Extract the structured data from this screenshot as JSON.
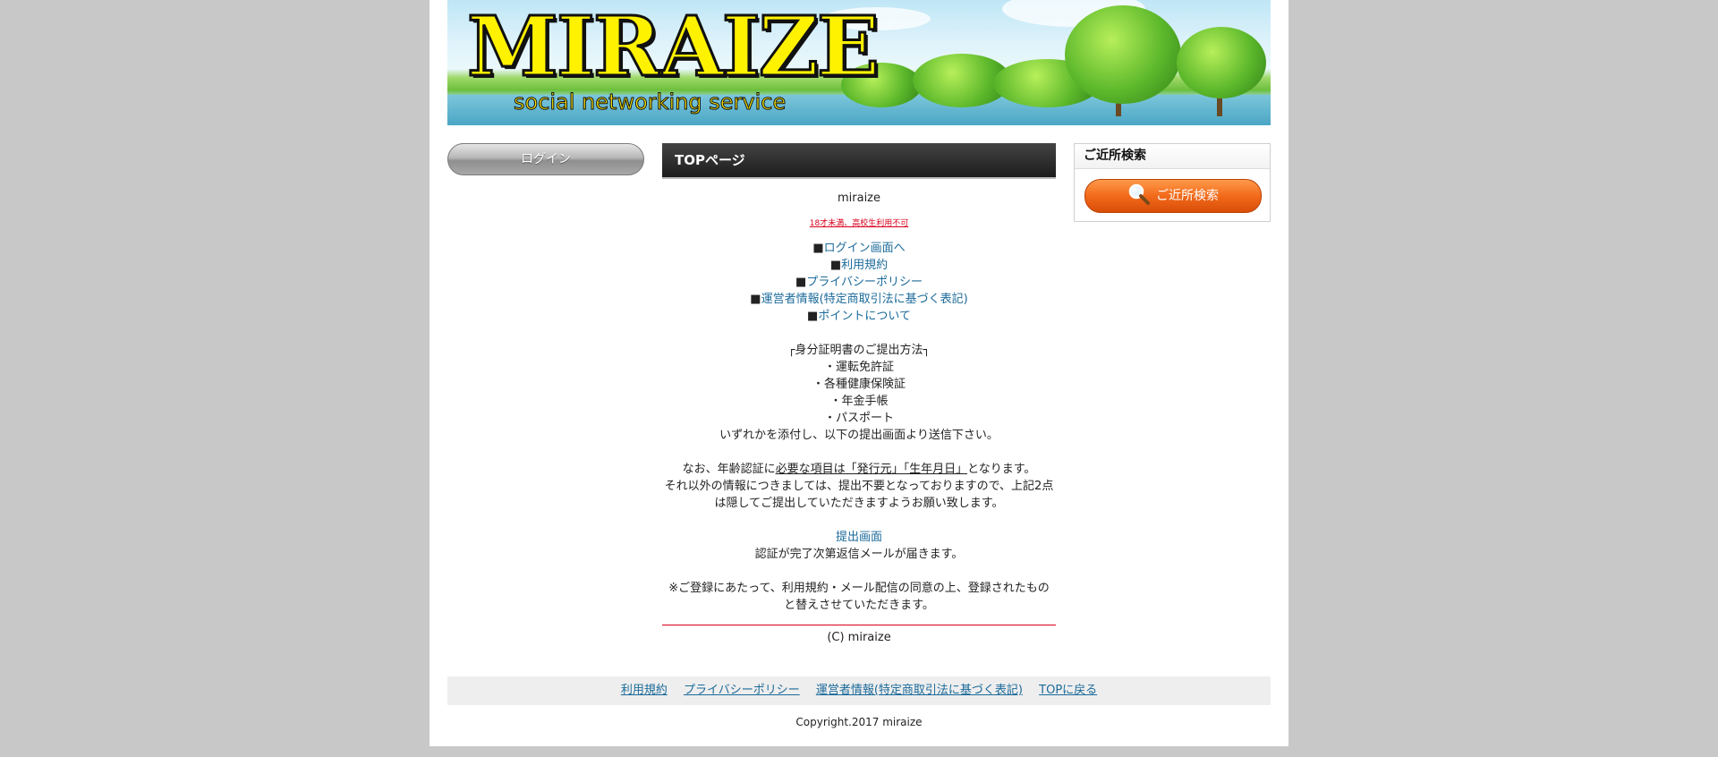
{
  "banner": {
    "brand": "MIRAIZE",
    "tagline": "social networking service"
  },
  "left": {
    "login_label": "ログイン"
  },
  "main": {
    "title": "TOPページ",
    "site_name": "miraize",
    "age_notice": "18才未満、高校生利用不可",
    "bullet": "■",
    "links": [
      "ログイン画面へ",
      "利用規約",
      "プライバシーポリシー",
      "運営者情報(特定商取引法に基づく表記)",
      "ポイントについて"
    ],
    "id_heading": "┌身分証明書のご提出方法┐",
    "id_items": [
      "・運転免許証",
      "・各種健康保険証",
      "・年金手帳",
      "・パスポート"
    ],
    "id_instruction": "いずれかを添付し、以下の提出画面より送信下さい。",
    "note_prefix": "なお、年齢認証に",
    "note_underlined": "必要な項目は「発行元」「生年月日」",
    "note_suffix": "となります。",
    "note_line2": "それ以外の情報につきましては、提出不要となっておりますので、上記2点",
    "note_line3": "は隠してご提出していただきますようお願い致します。",
    "submit_link": "提出画面",
    "submit_note": "認証が完了次第返信メールが届きます。",
    "register_note_1": "※ご登録にあたって、利用規約・メール配信の同意の上、登録されたもの",
    "register_note_2": "と替えさせていただきます。",
    "copyright_c": "(C) miraize"
  },
  "right": {
    "box_title": "ご近所検索",
    "search_label": "ご近所検索"
  },
  "footer": {
    "links": [
      "利用規約",
      "プライバシーポリシー",
      "運営者情報(特定商取引法に基づく表記)",
      "TOPに戻る"
    ],
    "copyright": "Copyright.2017 miraize"
  },
  "colors": {
    "background": "#c8c8c8",
    "link": "#1b6a9a",
    "notice_red": "#d8001c",
    "search_orange": "#f26a1b",
    "brand_yellow": "#fff200"
  },
  "icons": [
    "magnifier-icon"
  ]
}
